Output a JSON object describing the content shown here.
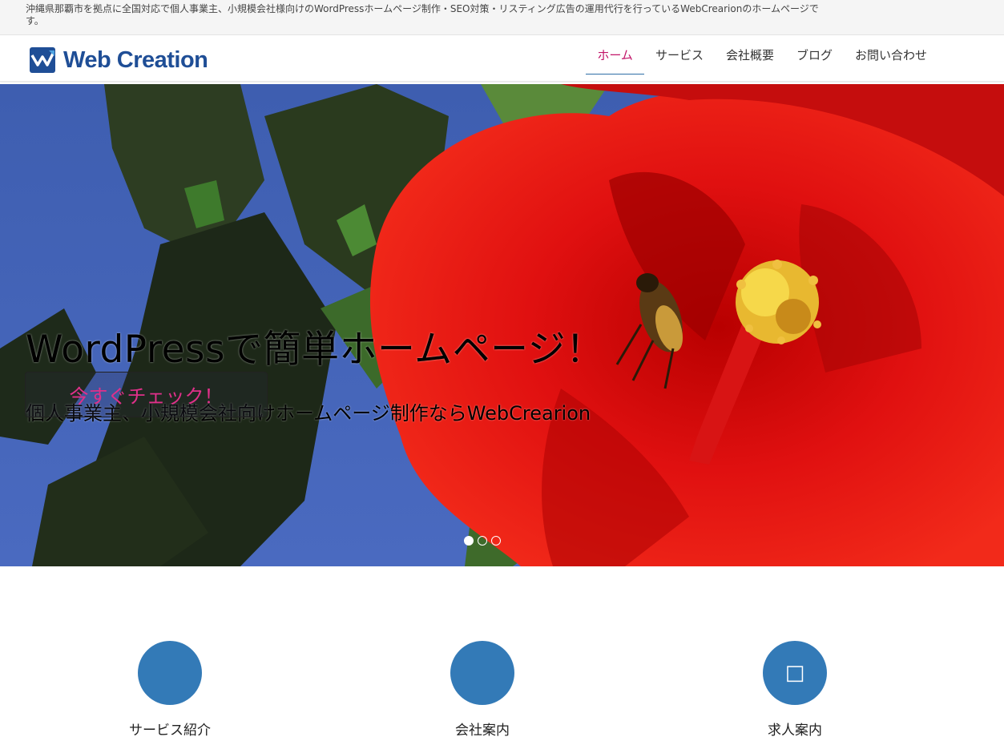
{
  "topbar": {
    "description": "沖縄県那覇市を拠点に全国対応で個人事業主、小規模会社様向けのWordPressホームページ制作・SEO対策・リスティング広告の運用代行を行っているWebCrearionのホームページです。"
  },
  "header": {
    "logo_text": "Web Creation"
  },
  "nav": {
    "items": [
      "ホーム",
      "サービス",
      "会社概要",
      "ブログ",
      "お問い合わせ"
    ],
    "active_index": 0
  },
  "hero": {
    "title": "WordPressで簡単ホームページ！",
    "subtitle": "個人事業主、小規模会社向けホームページ制作ならWebCrearion",
    "cta_label": "今すぐチェック！",
    "slide_count": 3,
    "active_slide": 1
  },
  "features": {
    "items": [
      {
        "title": "サービス紹介",
        "icon": "service-icon"
      },
      {
        "title": "会社案内",
        "icon": "company-icon"
      },
      {
        "title": "求人案内",
        "icon": "recruit-icon",
        "glyph": "□"
      }
    ]
  },
  "colors": {
    "accent": "#337ab7",
    "nav_active": "#c21569",
    "logo": "#1f4e96",
    "cta_text": "#e0308a"
  }
}
